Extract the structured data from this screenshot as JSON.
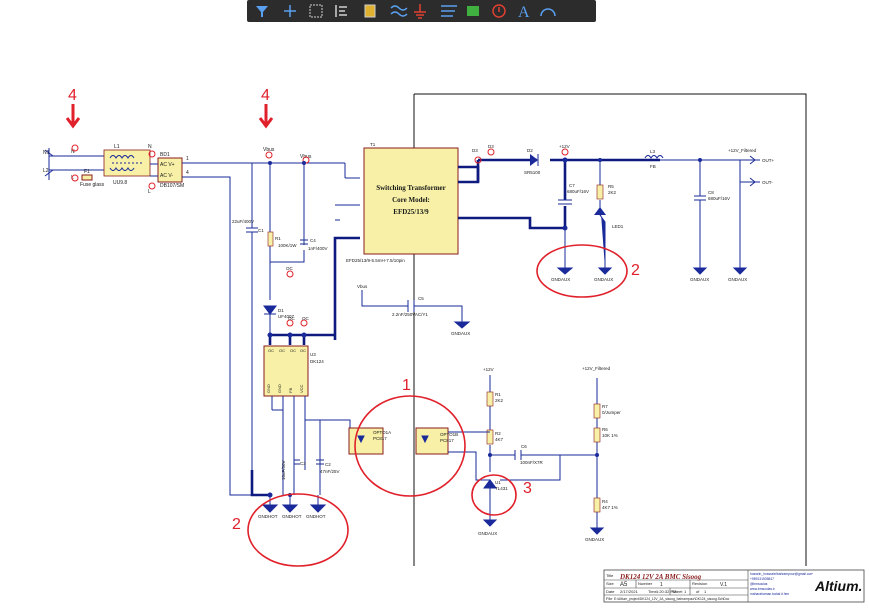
{
  "toolbar": {
    "tools": [
      {
        "name": "filter-tool-icon"
      },
      {
        "name": "crosshair-tool-icon"
      },
      {
        "name": "select-area-tool-icon"
      },
      {
        "name": "align-tool-icon"
      },
      {
        "name": "component-tool-icon"
      },
      {
        "name": "bus-tool-icon"
      },
      {
        "name": "ground-power-tool-icon"
      },
      {
        "name": "port-tool-icon"
      },
      {
        "name": "sheet-tool-icon"
      },
      {
        "name": "directive-tool-icon"
      },
      {
        "name": "text-tool-icon"
      },
      {
        "name": "arc-tool-icon"
      }
    ],
    "text_glyph": "A"
  },
  "annotations": {
    "one": "1",
    "two_a": "2",
    "two_b": "2",
    "three": "3",
    "four_a": "4",
    "four_b": "4"
  },
  "labels": {
    "n_in": "N1",
    "l_in": "L2",
    "n_node": "N",
    "l_node": "L",
    "fuse": "F1",
    "fuse_val": "Fuse glass",
    "l1": "L1",
    "l1_val": "UU9.8",
    "n_mid": "N",
    "l_mid": "L",
    "bd1": "BD1",
    "bd1_val": "DB107/SM",
    "acp": "AC V+",
    "acm": "AC V-",
    "p1": "1",
    "p4": "4",
    "vbus": "Vbus",
    "vbus2": "Vbus",
    "vbus3": "Vbus",
    "c1": "22uF/400V",
    "c1_name": "C1",
    "r1": "R1",
    "r1_val": "100K/1W",
    "c4": "C4",
    "c4_val": "1nF/400V",
    "d1": "D1",
    "d1_val": "UF4007",
    "oc": "OC",
    "u3": "U3",
    "u3_val": "DK124",
    "ic_pins_top": [
      "OC",
      "OC",
      "OC",
      "OC"
    ],
    "ic_pins_bot": [
      "GND",
      "GND",
      "FB",
      "VCC"
    ],
    "c3": "C3",
    "c3_val": "10uF/50V",
    "c2": "C2",
    "c2_val": "47nF/25V",
    "gndhot": "GNDHOT",
    "t1": "T1",
    "t1_title_1": "Switching Transformer",
    "t1_title_2": "Core Model:",
    "t1_title_3": "EFD25/13/9",
    "t1_val": "EFD25/13/9-5.5mH-7.5/10pin",
    "d3": "D3",
    "d2": "D2",
    "d2_val": "SR5100",
    "p12v": "+12V",
    "c7": "C7",
    "c7_val": "680uF/16V",
    "r5": "R5",
    "r5_val": "2K2",
    "led": "LED1",
    "l3": "L3",
    "l3_val": "FB",
    "p12vf": "+12V_Filtered",
    "c8": "C8",
    "c8_val": "680uF/16V",
    "out_p": "OUT+",
    "out_m": "OUT-",
    "gndaux": "GNDAUX",
    "vbus_c": "Vbus",
    "c5": "C5",
    "c5_val": "2.2nF/250VAC/Y1",
    "p12v_b": "+12V",
    "r1b": "R1",
    "r1b_val": "2K2",
    "r2": "R2",
    "r2_val": "4K7",
    "opto_a": "OPTO1A",
    "opto_a_val": "PC817",
    "opto_b": "OPTO1B",
    "opto_b_val": "PC817",
    "c6": "C6",
    "c6_val": "100nF/X7R",
    "u1": "U1",
    "u1_val": "TL431",
    "p12vf_b": "+12V_Filtered",
    "r7": "R7",
    "r7_val": "0/Jumper",
    "r6": "R6",
    "r6_val": "10K 1%",
    "r4": "R4",
    "r4_val": "4K7 1%"
  },
  "title_block": {
    "title_label": "Title",
    "title": "DK124 12V 2A BMC Sisoog",
    "size_label": "Size",
    "size": "A5",
    "number_label": "Number",
    "number": "1",
    "revision_label": "Revision",
    "revision": "V.1",
    "date_label": "Date",
    "date": "2/17/2021",
    "time_label": "Time",
    "time": "1:20:32 PM",
    "sheet_label": "Sheet",
    "sheet": "1",
    "of_label": "of",
    "of": "1",
    "file_label": "File",
    "file": "E:\\Altium_project\\DK124_12V_2A_sisoog_bahrampour\\DK124_sisoog.SchDoc",
    "contact_1": "hossein_hossseinlbahrampour@gmail.com",
    "contact_2": "+989131505847",
    "contact_3": "@bmsoulas",
    "contact_4": "www.bmsoulas.ir",
    "contact_5": "maharahaman.bahal.it.hen",
    "logo": "Altium."
  },
  "colors": {
    "wire": "#1a2a9a",
    "bus": "#0e1a80",
    "body": "#f7f0a6",
    "body_stroke": "#8a1c1c",
    "annotation": "#e0202a",
    "text": "#1a1a1a",
    "toolbar_bg": "#2c2c2c"
  }
}
